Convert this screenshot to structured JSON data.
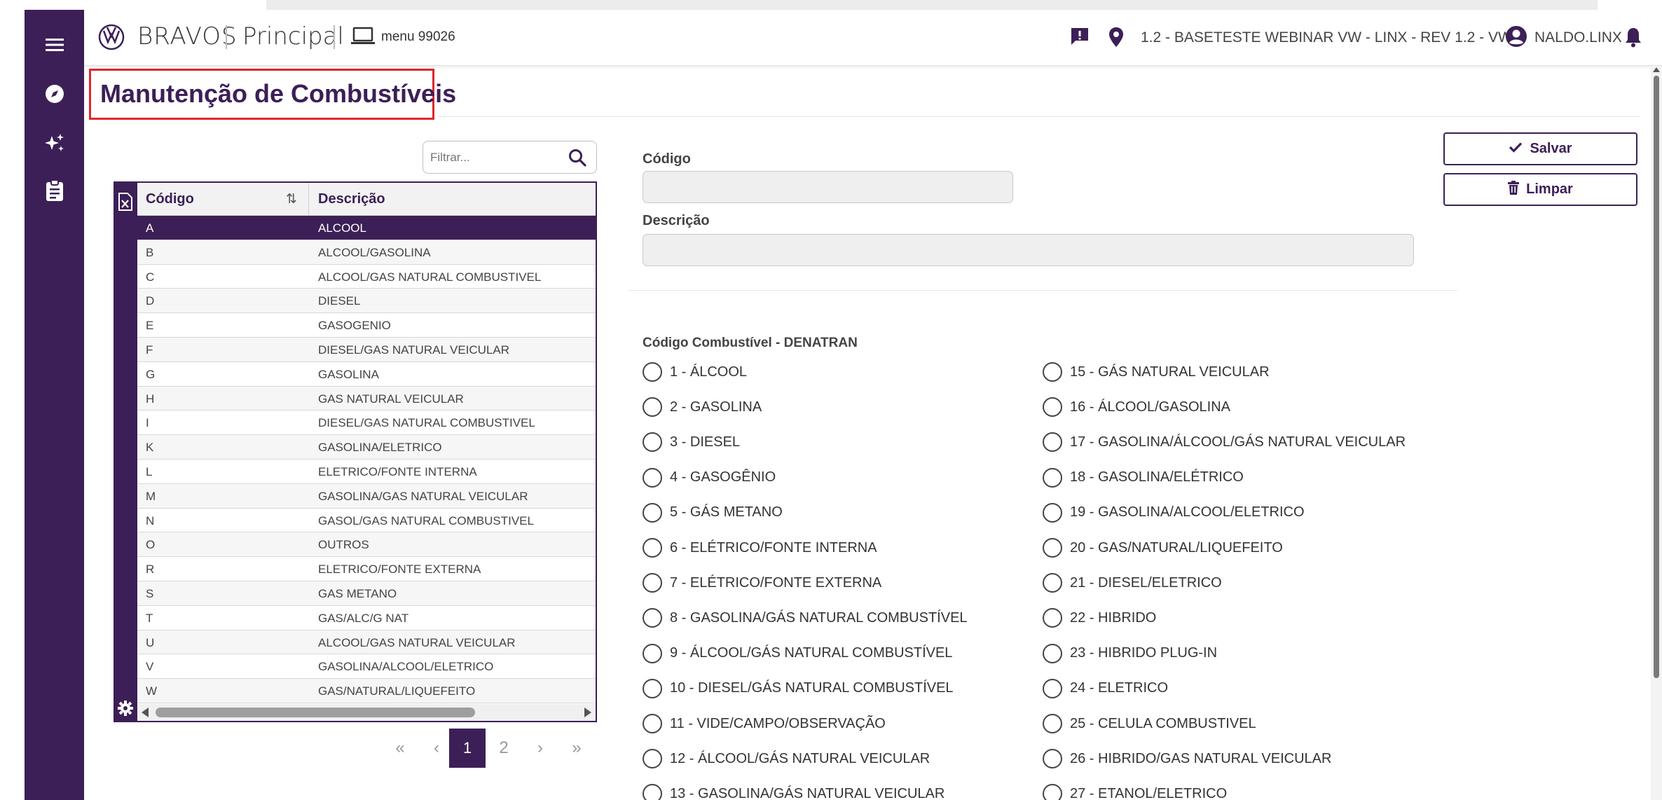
{
  "header": {
    "brand": "BRAVOS",
    "module": "Principal",
    "menu": "menu 99026",
    "branch": "1.2 - BASETESTE WEBINAR VW - LINX - REV 1.2 - VW",
    "user": "NALDO.LINX"
  },
  "sidebar": {
    "icons": [
      "menu-icon",
      "compass-icon",
      "sparkles-icon",
      "clipboard-icon"
    ]
  },
  "page": {
    "title": "Manutenção de Combustíveis"
  },
  "filter": {
    "placeholder": "Filtrar..."
  },
  "table": {
    "columns": [
      "Código",
      "Descrição"
    ],
    "sort_glyph": "⇅",
    "rows": [
      {
        "code": "A",
        "desc": "ALCOOL"
      },
      {
        "code": "B",
        "desc": "ALCOOL/GASOLINA"
      },
      {
        "code": "C",
        "desc": "ALCOOL/GAS NATURAL COMBUSTIVEL"
      },
      {
        "code": "D",
        "desc": "DIESEL"
      },
      {
        "code": "E",
        "desc": "GASOGENIO"
      },
      {
        "code": "F",
        "desc": "DIESEL/GAS NATURAL VEICULAR"
      },
      {
        "code": "G",
        "desc": "GASOLINA"
      },
      {
        "code": "H",
        "desc": "GAS NATURAL VEICULAR"
      },
      {
        "code": "I",
        "desc": "DIESEL/GAS NATURAL COMBUSTIVEL"
      },
      {
        "code": "K",
        "desc": "GASOLINA/ELETRICO"
      },
      {
        "code": "L",
        "desc": "ELETRICO/FONTE INTERNA"
      },
      {
        "code": "M",
        "desc": "GASOLINA/GAS NATURAL VEICULAR"
      },
      {
        "code": "N",
        "desc": "GASOL/GAS NATURAL COMBUSTIVEL"
      },
      {
        "code": "O",
        "desc": "OUTROS"
      },
      {
        "code": "R",
        "desc": "ELETRICO/FONTE EXTERNA"
      },
      {
        "code": "S",
        "desc": "GAS METANO"
      },
      {
        "code": "T",
        "desc": "GAS/ALC/G NAT"
      },
      {
        "code": "U",
        "desc": "ALCOOL/GAS NATURAL VEICULAR"
      },
      {
        "code": "V",
        "desc": "GASOLINA/ALCOOL/ELETRICO"
      },
      {
        "code": "W",
        "desc": "GAS/NATURAL/LIQUEFEITO"
      }
    ],
    "selected_index": 0
  },
  "pagination": {
    "first": "«",
    "prev": "‹",
    "pages": [
      "1",
      "2"
    ],
    "current": "1",
    "next": "›",
    "last": "»"
  },
  "form": {
    "code_label": "Código",
    "code_value": "",
    "desc_label": "Descrição",
    "desc_value": "",
    "save_label": "Salvar",
    "clear_label": "Limpar",
    "denatran_label": "Código Combustível - DENATRAN",
    "options_left": [
      "1 - ÁLCOOL",
      "2 - GASOLINA",
      "3 - DIESEL",
      "4 - GASOGÊNIO",
      "5 - GÁS METANO",
      "6 - ELÉTRICO/FONTE INTERNA",
      "7 - ELÉTRICO/FONTE EXTERNA",
      "8 - GASOLINA/GÁS NATURAL COMBUSTÍVEL",
      "9 - ÁLCOOL/GÁS NATURAL COMBUSTÍVEL",
      "10 - DIESEL/GÁS NATURAL COMBUSTÍVEL",
      "11 - VIDE/CAMPO/OBSERVAÇÃO",
      "12 - ÁLCOOL/GÁS NATURAL VEICULAR",
      "13 - GASOLINA/GÁS NATURAL VEICULAR"
    ],
    "options_right": [
      "15 - GÁS NATURAL VEICULAR",
      "16 - ÁLCOOL/GASOLINA",
      "17 - GASOLINA/ÁLCOOL/GÁS NATURAL VEICULAR",
      "18 - GASOLINA/ELÉTRICO",
      "19 - GASOLINA/ALCOOL/ELETRICO",
      "20 - GAS/NATURAL/LIQUEFEITO",
      "21 - DIESEL/ELETRICO",
      "22 - HIBRIDO",
      "23 - HIBRIDO PLUG-IN",
      "24 - ELETRICO",
      "25 - CELULA COMBUSTIVEL",
      "26 - HIBRIDO/GAS NATURAL VEICULAR",
      "27 - ETANOL/ELETRICO"
    ]
  },
  "colors": {
    "primary": "#3c1f57",
    "highlight_border": "#e0262c"
  }
}
